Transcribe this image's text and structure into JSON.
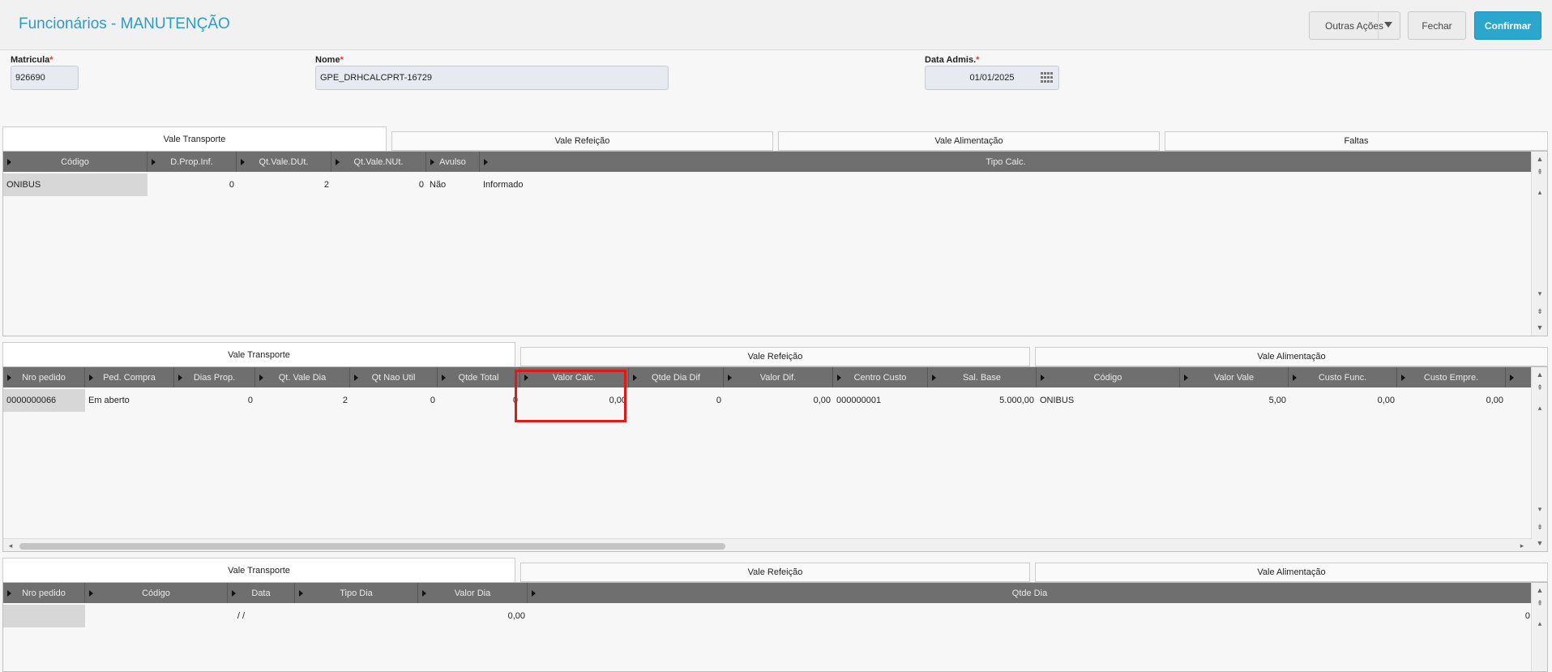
{
  "header": {
    "title": "Funcionários - MANUTENÇÃO",
    "buttons": {
      "outras": "Outras Ações",
      "fechar": "Fechar",
      "confirmar": "Confirmar"
    }
  },
  "fields": {
    "matricula": {
      "label": "Matricula",
      "required": "*",
      "value": "926690"
    },
    "nome": {
      "label": "Nome",
      "required": "*",
      "value": "GPE_DRHCALCPRT-16729"
    },
    "data_admis": {
      "label": "Data Admis.",
      "required": "*",
      "value": "01/01/2025"
    }
  },
  "section1": {
    "tabs": [
      "Vale Transporte",
      "Vale Refeição",
      "Vale Alimentação",
      "Faltas"
    ],
    "columns": [
      "Código",
      "D.Prop.Inf.",
      "Qt.Vale.DUt.",
      "Qt.Vale.NUt.",
      "Avulso",
      "Tipo Calc."
    ],
    "rows": [
      [
        "ONIBUS",
        "0",
        "2",
        "0",
        "Não",
        "Informado"
      ]
    ]
  },
  "section2": {
    "tabs": [
      "Vale Transporte",
      "Vale Refeição",
      "Vale Alimentação"
    ],
    "columns": [
      "Nro pedido",
      "Ped. Compra",
      "Dias Prop.",
      "Qt. Vale Dia",
      "Qt Nao Util",
      "Qtde Total",
      "Valor Calc.",
      "Qtde Dia Dif",
      "Valor Dif.",
      "Centro Custo",
      "Sal. Base",
      "Código",
      "Valor Vale",
      "Custo Func.",
      "Custo Empre."
    ],
    "rows": [
      [
        "0000000066",
        "Em aberto",
        "0",
        "2",
        "0",
        "0",
        "0,00",
        "0",
        "0,00",
        "000000001",
        "5.000,00",
        "ONIBUS",
        "5,00",
        "0,00",
        "0,00"
      ]
    ]
  },
  "section3": {
    "tabs": [
      "Vale Transporte",
      "Vale Refeição",
      "Vale Alimentação"
    ],
    "columns": [
      "Nro pedido",
      "Código",
      "Data",
      "Tipo Dia",
      "Valor Dia",
      "Qtde Dia"
    ],
    "rows": [
      [
        "",
        "",
        "/ /",
        "",
        "0,00",
        "0"
      ]
    ]
  },
  "colors": {
    "accent": "#2ba6cd",
    "title": "#2a9cc9",
    "header_grid": "#6f6f6f",
    "highlight": "#e01818"
  }
}
